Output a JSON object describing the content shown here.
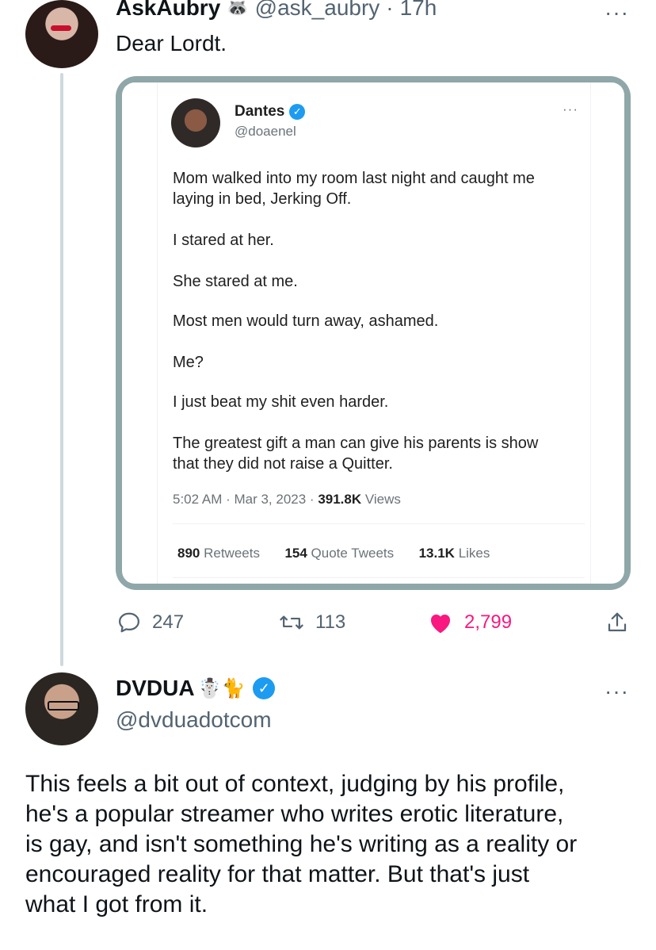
{
  "tweet1": {
    "name": "AskAubry",
    "name_emoji": "🦝",
    "handle": "@ask_aubry",
    "sep": "·",
    "time": "17h",
    "more": "···",
    "text": "Dear Lordt."
  },
  "quoted": {
    "name": "Dantes",
    "handle": "@doaenel",
    "more": "···",
    "paragraphs": [
      "Mom walked into my room last night and caught me",
      "laying in bed, Jerking Off.",
      "I stared at her.",
      "She stared at me.",
      "Most men would turn away, ashamed.",
      "Me?",
      "I just beat my shit even harder.",
      "The greatest gift a man can give his parents is show",
      "that they did not raise a Quitter."
    ],
    "timestamp": "5:02 AM · Mar 3, 2023 · ",
    "views_count": "391.8K",
    "views_label": " Views",
    "retweets_count": "890",
    "retweets_label": " Retweets",
    "quotes_count": "154",
    "quotes_label": " Quote Tweets",
    "likes_count": "13.1K",
    "likes_label": " Likes"
  },
  "actions": {
    "replies": "247",
    "retweets": "113",
    "likes": "2,799"
  },
  "tweet2": {
    "name": "DVDUA",
    "name_emoji": "☃️🐈",
    "handle": "@dvduadotcom",
    "more": "···",
    "lines": [
      "This feels a bit out of context, judging by his profile,",
      "he's a popular streamer who writes erotic literature,",
      "is gay, and isn't something he's writing as a reality or",
      "encouraged reality for that matter.  But that's just",
      "what I got from it."
    ]
  },
  "colors": {
    "like": "#f91880",
    "verified": "#1d9bf0",
    "frame": "#8fa7a8"
  },
  "icons": [
    "raccoon-icon",
    "verified-icon",
    "reply-icon",
    "retweet-icon",
    "heart-icon",
    "share-icon",
    "more-icon"
  ]
}
